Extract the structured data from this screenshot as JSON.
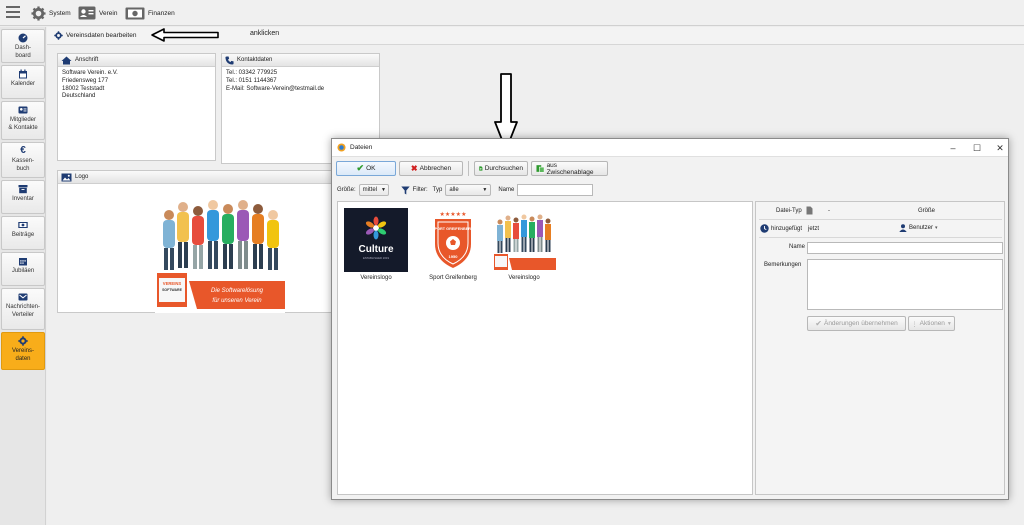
{
  "topbar": {
    "system_label": "System",
    "verein_label": "Verein",
    "finanzen_label": "Finanzen"
  },
  "sidebar": {
    "items": [
      {
        "label": "Dash-\nboard"
      },
      {
        "label": "Kalender"
      },
      {
        "label": "Mitglieder\n& Kontakte"
      },
      {
        "label": "Kassen-\nbuch"
      },
      {
        "label": "Inventar"
      },
      {
        "label": "Beiträge"
      },
      {
        "label": "Jubiläen"
      },
      {
        "label": "Nachrichten-\nVerteiler"
      },
      {
        "label": "Vereins-\ndaten"
      }
    ]
  },
  "subbar": {
    "edit_link": "Vereinsdaten bearbeiten",
    "annotation": "anklicken"
  },
  "address": {
    "title": "Anschrift",
    "line1": "Software Verein. e.V.",
    "line2": "Friedensweg 177",
    "line3": "18002 Teststadt",
    "line4": "Deutschland"
  },
  "contact": {
    "title": "Kontaktdaten",
    "tel1": "Tel.: 03342 779925",
    "tel2": "Tel.: 0151 1144367",
    "email": "E-Mail: Software-Verein@testmail.de"
  },
  "logo_panel": {
    "title": "Logo",
    "banner_line1": "Die Softwarelösung",
    "banner_line2": "für unseren Verein",
    "box_text1": "VEREINS",
    "box_text2": "SOFTWARE"
  },
  "dialog": {
    "title": "Dateien",
    "ok": "OK",
    "cancel": "Abbrechen",
    "browse": "Durchsuchen",
    "clipboard": "aus Zwischenablage",
    "size_label": "Größe:",
    "size_value": "mittel",
    "filter_label": "Filter:",
    "type_label": "Typ",
    "type_value": "alle",
    "name_label": "Name",
    "files": [
      {
        "caption": "Vereinslogo",
        "thumb_text": "Culture",
        "thumb_sub": "ESTABLISHED 2019"
      },
      {
        "caption": "Sport Greifenberg",
        "thumb_text": "SPORT GREIFENBERG",
        "thumb_sub": "1950"
      },
      {
        "caption": "Vereinslogo"
      }
    ],
    "details": {
      "filetype_label": "Datei-Typ",
      "filetype_value": "-",
      "size_label": "Größe",
      "added_label": "hinzugefügt",
      "added_value": "jetzt",
      "user_label": "Benutzer",
      "name_label": "Name",
      "remarks_label": "Bemerkungen",
      "apply_button": "Änderungen übernehmen",
      "actions_button": "Aktionen"
    }
  },
  "colors": {
    "accent": "#f8ad1a",
    "banner_orange": "#e8572a",
    "culture_bg": "#141a2a"
  }
}
